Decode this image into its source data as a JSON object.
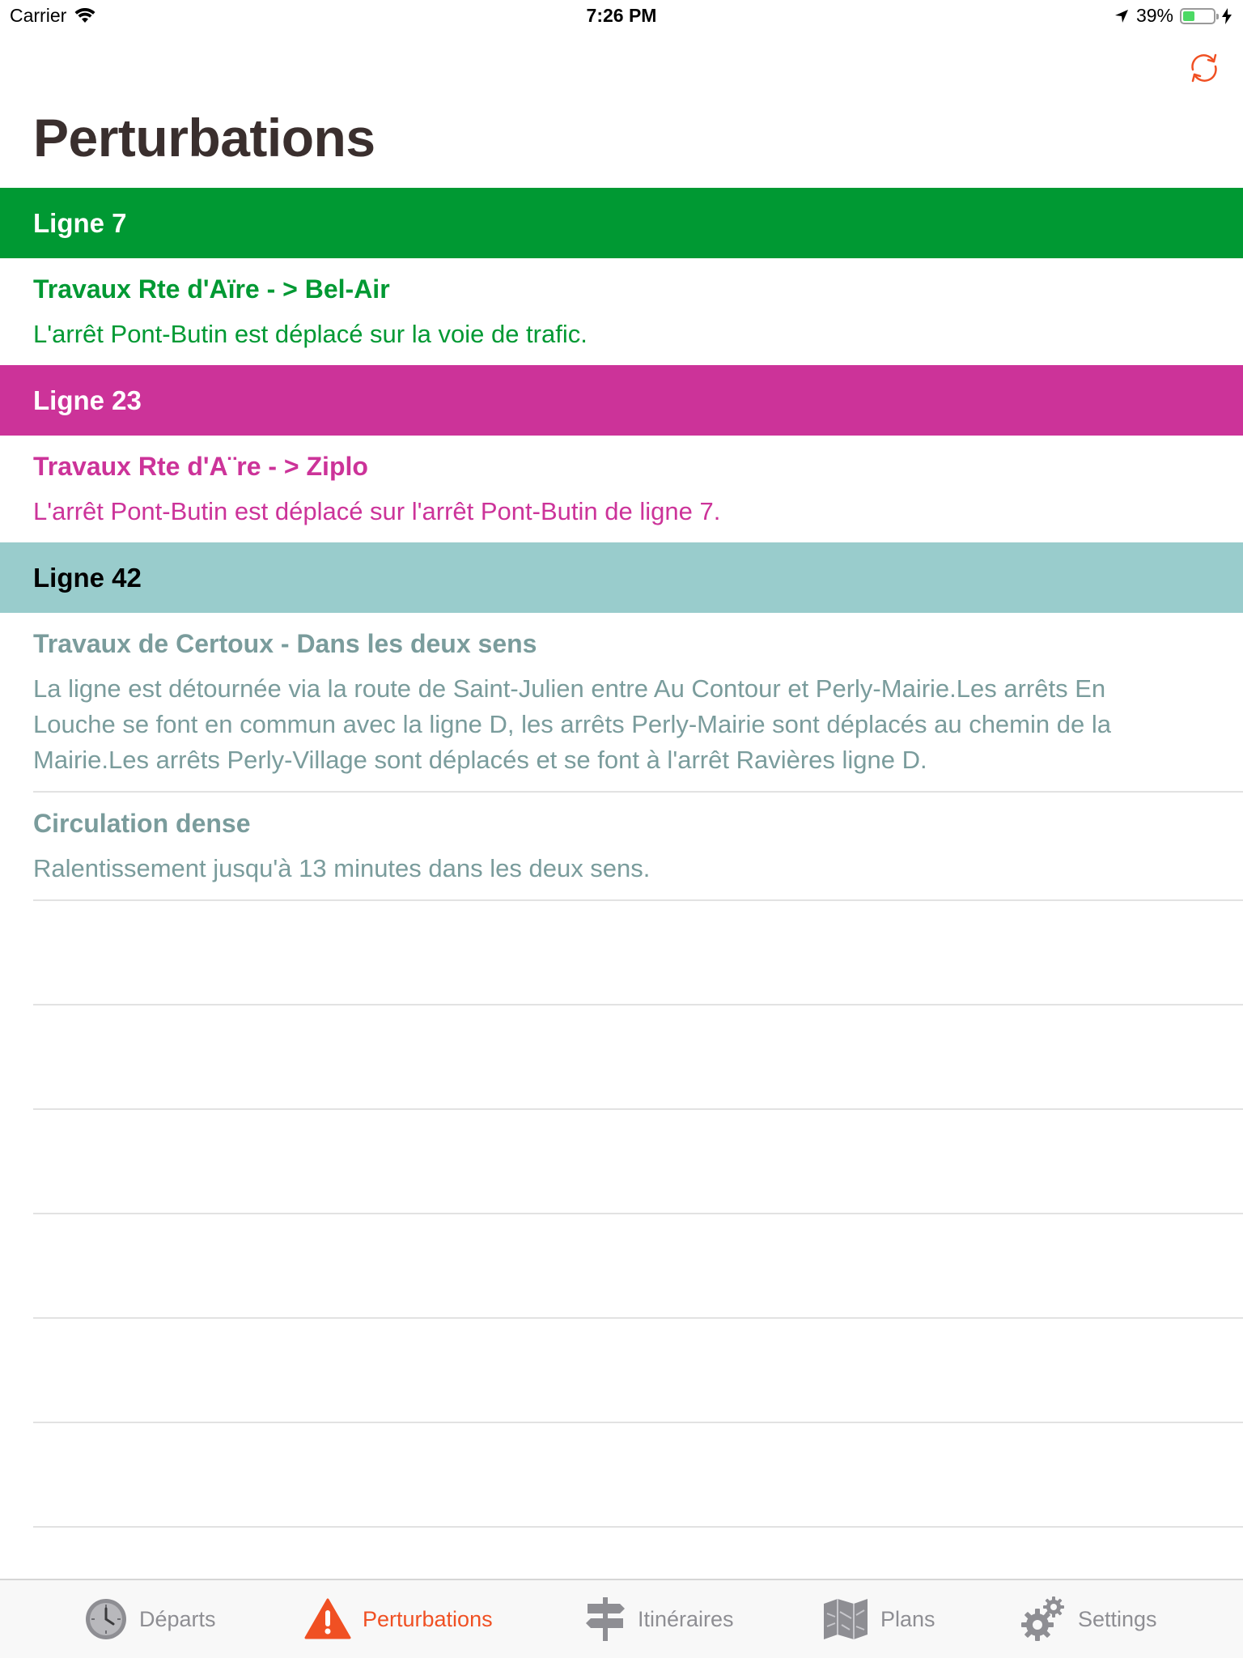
{
  "status_bar": {
    "carrier": "Carrier",
    "time": "7:26 PM",
    "battery_percent": "39%",
    "battery_level": 0.39,
    "battery_color": "#4cd964"
  },
  "nav": {
    "title": "Perturbations",
    "refresh_icon": "refresh-icon",
    "accent_color": "#f05023"
  },
  "sections": [
    {
      "header": "Ligne 7",
      "header_bg": "#009933",
      "header_text_color": "#ffffff",
      "text_color": "#009933",
      "items": [
        {
          "title": "Travaux Rte d'Aïre - > Bel-Air",
          "description": "L'arrêt Pont-Butin est déplacé sur la voie de trafic."
        }
      ]
    },
    {
      "header": "Ligne 23",
      "header_bg": "#cc3399",
      "header_text_color": "#ffffff",
      "text_color": "#cc3399",
      "items": [
        {
          "title": "Travaux Rte d'A¨re - > Ziplo",
          "description": "L'arrêt Pont-Butin est déplacé sur l'arrêt Pont-Butin de ligne 7."
        }
      ]
    },
    {
      "header": "Ligne 42",
      "header_bg": "#99cccc",
      "header_text_color": "#000000",
      "text_color": "#7a9c9c",
      "items": [
        {
          "title": "Travaux de Certoux - Dans les deux sens",
          "description": "La ligne est détournée via la route de Saint-Julien entre Au Contour et Perly-Mairie.Les arrêts En Louche se font en commun avec la ligne D, les arrêts Perly-Mairie sont déplacés au chemin de la Mairie.Les arrêts Perly-Village sont déplacés et se font à l'arrêt Ravières ligne D."
        },
        {
          "title": "Circulation dense",
          "description": "Ralentissement jusqu'à 13 minutes dans les deux sens."
        }
      ]
    }
  ],
  "tab_bar": {
    "tabs": [
      {
        "label": "Départs",
        "icon": "clock-icon",
        "active": false
      },
      {
        "label": "Perturbations",
        "icon": "warning-icon",
        "active": true
      },
      {
        "label": "Itinéraires",
        "icon": "signpost-icon",
        "active": false
      },
      {
        "label": "Plans",
        "icon": "map-icon",
        "active": false
      },
      {
        "label": "Settings",
        "icon": "gears-icon",
        "active": false
      }
    ]
  }
}
